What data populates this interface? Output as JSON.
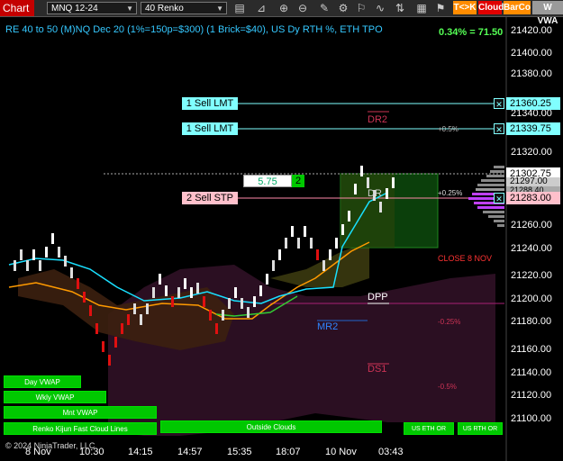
{
  "toolbar": {
    "title": "Chart",
    "instrument": "MNQ 12-24",
    "period": "40 Renko",
    "tk_label": "T<>K",
    "cloud_label": "Cloud",
    "barco_label": "BarCo",
    "vwap_label": "W VWA",
    "colors": {
      "title_bg": "#c40000",
      "tk_bg": "#ff8c00",
      "cloud_bg": "#e00000",
      "barco_bg": "#ff8c00"
    }
  },
  "chart": {
    "header": "RE 40 to 50 (M)NQ Dec 20 (1%=150p=$300) (1 Brick=$40), US Dy RTH %, ETH TPO",
    "pct_readout": "0.34% = 71.50",
    "price_ticks": [
      "21420.00",
      "21400.00",
      "21380.00",
      "21340.00",
      "21320.00",
      "21260.00",
      "21240.00",
      "21220.00",
      "21200.00",
      "21180.00",
      "21160.00",
      "21140.00",
      "21120.00",
      "21100.00"
    ],
    "price_boxes": {
      "p1": "21360.25",
      "p2": "21339.75",
      "p3": "21302.75",
      "p4": "21297.00",
      "p5": "21288.40",
      "p6": "21283.00"
    },
    "orders": {
      "sell_lmt_1": "1 Sell LMT",
      "sell_lmt_2": "1 Sell LMT",
      "sell_stp": "2 Sell STP",
      "qty_box": "5.75",
      "qty_count": "2",
      "close_x": "✕"
    },
    "levels": {
      "dr2": "DR2",
      "dr": "DR",
      "dpp": "DPP",
      "mr2": "MR2",
      "ds1": "DS1",
      "pct_plus_05": "+0.5%",
      "pct_plus_025": "+0.25%",
      "pct_minus_025": "-0.25%",
      "pct_minus_05": "-0.5%",
      "close_8nov": "CLOSE 8 NOV"
    },
    "buttons": {
      "day_vwap": "Day VWAP",
      "wkly_vwap": "Wkly VWAP",
      "mnt_vwap": "Mnt VWAP",
      "fast_cloud": "Renko Kijun Fast Cloud Lines",
      "outside_clouds": "Outside Clouds",
      "us_eth_or": "US ETH OR",
      "us_rth_or": "US RTH OR"
    },
    "copyright": "© 2024 NinjaTrader, LLC",
    "time_labels": [
      "8 Nov",
      "10:30",
      "14:15",
      "14:57",
      "15:35",
      "18:07",
      "10 Nov",
      "03:43"
    ]
  }
}
